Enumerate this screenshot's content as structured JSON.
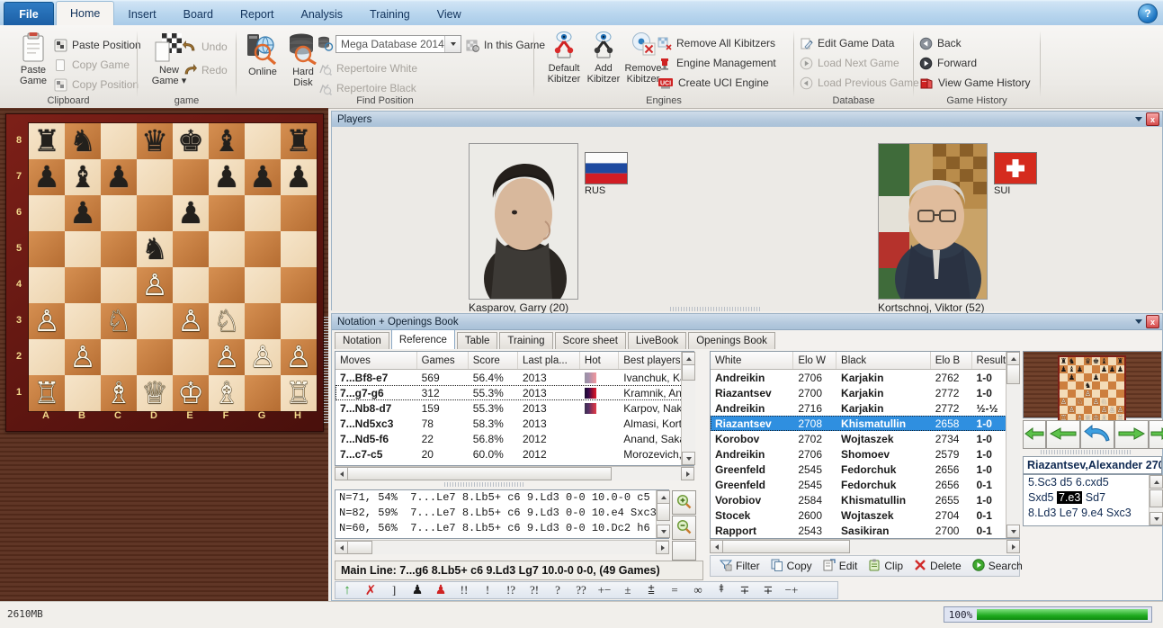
{
  "window": {
    "help_icon": "help-icon"
  },
  "ribbon": {
    "tabs": [
      {
        "label": "File",
        "active": false
      },
      {
        "label": "Home",
        "active": true
      },
      {
        "label": "Insert",
        "active": false
      },
      {
        "label": "Board",
        "active": false
      },
      {
        "label": "Report",
        "active": false
      },
      {
        "label": "Analysis",
        "active": false
      },
      {
        "label": "Training",
        "active": false
      },
      {
        "label": "View",
        "active": false
      }
    ],
    "groups": [
      {
        "name": "Clipboard",
        "label": "Clipboard"
      },
      {
        "name": "game",
        "label": "game"
      },
      {
        "name": "FindPosition",
        "label": "Find Position"
      },
      {
        "name": "Engines",
        "label": "Engines"
      },
      {
        "name": "Database",
        "label": "Database"
      },
      {
        "name": "GameHistory",
        "label": "Game History"
      }
    ],
    "clipboard": {
      "paste_game": "Paste\nGame",
      "paste_game_l1": "Paste",
      "paste_game_l2": "Game",
      "paste_position": "Paste Position",
      "copy_game": "Copy Game",
      "copy_position": "Copy Position"
    },
    "game": {
      "new_game_l1": "New",
      "new_game_l2": "Game",
      "undo": "Undo",
      "redo": "Redo"
    },
    "find": {
      "online_l1": "Online",
      "hard_disk_l1": "Hard",
      "hard_disk_l2": "Disk",
      "database": "Mega Database 2014",
      "in_this_game": "In this Game",
      "repertoire_white": "Repertoire White",
      "repertoire_black": "Repertoire Black"
    },
    "engines": {
      "default_l1": "Default",
      "default_l2": "Kibitzer",
      "add_l1": "Add",
      "add_l2": "Kibitzer",
      "remove_l1": "Remove",
      "remove_l2": "Kibitzer",
      "remove_all": "Remove All Kibitzers",
      "engine_management": "Engine Management",
      "create_uci": "Create UCI Engine"
    },
    "database": {
      "edit_game_data": "Edit Game Data",
      "load_next": "Load Next Game",
      "load_prev": "Load Previous Game"
    },
    "history": {
      "back": "Back",
      "forward": "Forward",
      "view_history": "View Game History"
    }
  },
  "board": {
    "files": [
      "A",
      "B",
      "C",
      "D",
      "E",
      "F",
      "G",
      "H"
    ],
    "ranks": [
      "8",
      "7",
      "6",
      "5",
      "4",
      "3",
      "2",
      "1"
    ],
    "rows": [
      [
        "br",
        "bn",
        "",
        "bq",
        "bk",
        "bb",
        "",
        "br"
      ],
      [
        "bp",
        "bb",
        "bp",
        "",
        "",
        "bp",
        "bp",
        "bp"
      ],
      [
        "",
        "bp",
        "",
        "",
        "bp",
        "",
        "",
        ""
      ],
      [
        "",
        "",
        "",
        "bn",
        "",
        "",
        "",
        ""
      ],
      [
        "",
        "",
        "",
        "wp",
        "",
        "",
        "",
        ""
      ],
      [
        "wp",
        "",
        "wn",
        "",
        "wp",
        "wn",
        "",
        ""
      ],
      [
        "",
        "wp",
        "",
        "",
        "",
        "wp",
        "wp",
        "wp"
      ],
      [
        "wr",
        "",
        "wb",
        "wq",
        "wk",
        "wb",
        "",
        "wr"
      ]
    ]
  },
  "players_panel": {
    "title": "Players",
    "white": {
      "name": "Kasparov, Garry  (20)",
      "country": "RUS",
      "flag": "russia-flag"
    },
    "black": {
      "name": "Kortschnoj, Viktor  (52)",
      "country": "SUI",
      "flag": "switzerland-flag"
    }
  },
  "notation_panel": {
    "title": "Notation + Openings Book",
    "tabs": [
      {
        "label": "Notation",
        "active": false
      },
      {
        "label": "Reference",
        "active": true
      },
      {
        "label": "Table",
        "active": false
      },
      {
        "label": "Training",
        "active": false
      },
      {
        "label": "Score sheet",
        "active": false
      },
      {
        "label": "LiveBook",
        "active": false
      },
      {
        "label": "Openings Book",
        "active": false
      }
    ],
    "moves_table": {
      "headers": [
        "Moves",
        "Games",
        "Score",
        "Last pla...",
        "Hot",
        "Best players"
      ],
      "rows": [
        {
          "move": "7...Bf8-e7",
          "games": "569",
          "score": "56.4%",
          "last": "2013",
          "hot": 0.15,
          "players": "Ivanchuk, Ka",
          "selected": false
        },
        {
          "move": "7...g7-g6",
          "games": "312",
          "score": "55.3%",
          "last": "2013",
          "hot": 1.0,
          "players": "Kramnik, Ana",
          "selected": true
        },
        {
          "move": "7...Nb8-d7",
          "games": "159",
          "score": "55.3%",
          "last": "2013",
          "hot": 0.85,
          "players": "Karpov, Naka",
          "selected": false
        },
        {
          "move": "7...Nd5xc3",
          "games": "78",
          "score": "58.3%",
          "last": "2013",
          "hot": 0,
          "players": "Almasi, Korts",
          "selected": false
        },
        {
          "move": "7...Nd5-f6",
          "games": "22",
          "score": "56.8%",
          "last": "2012",
          "hot": 0,
          "players": "Anand, Saka",
          "selected": false
        },
        {
          "move": "7...c7-c5",
          "games": "20",
          "score": "60.0%",
          "last": "2012",
          "hot": 0,
          "players": "Morozevich,",
          "selected": false
        }
      ]
    },
    "variations": [
      "N=71, 54%  7...Le7 8.Lb5+ c6 9.Ld3 0-0 10.0-0 c5",
      "N=82, 59%  7...Le7 8.Lb5+ c6 9.Ld3 0-0 10.e4 Sxc3",
      "N=60, 56%  7...Le7 8.Lb5+ c6 9.Ld3 0-0 10.Dc2 h6"
    ],
    "main_line": "Main Line: 7...g6 8.Lb5+ c6 9.Ld3 Lg7 10.0-0 0-0,  (49 Games)",
    "zoom_in_icon": "zoom-in-icon",
    "zoom_out_icon": "zoom-out-icon"
  },
  "games_table": {
    "headers": [
      "White",
      "Elo W",
      "Black",
      "Elo B",
      "Result"
    ],
    "rows": [
      {
        "white": "Andreikin",
        "elow": "2706",
        "black": "Karjakin",
        "elob": "2762",
        "result": "1-0",
        "selected": false
      },
      {
        "white": "Riazantsev",
        "elow": "2700",
        "black": "Karjakin",
        "elob": "2772",
        "result": "1-0",
        "selected": false
      },
      {
        "white": "Andreikin",
        "elow": "2716",
        "black": "Karjakin",
        "elob": "2772",
        "result": "½-½",
        "selected": false
      },
      {
        "white": "Riazantsev",
        "elow": "2708",
        "black": "Khismatullin",
        "elob": "2658",
        "result": "1-0",
        "selected": true
      },
      {
        "white": "Korobov",
        "elow": "2702",
        "black": "Wojtaszek",
        "elob": "2734",
        "result": "1-0",
        "selected": false
      },
      {
        "white": "Andreikin",
        "elow": "2706",
        "black": "Shomoev",
        "elob": "2579",
        "result": "1-0",
        "selected": false
      },
      {
        "white": "Greenfeld",
        "elow": "2545",
        "black": "Fedorchuk",
        "elob": "2656",
        "result": "1-0",
        "selected": false
      },
      {
        "white": "Greenfeld",
        "elow": "2545",
        "black": "Fedorchuk",
        "elob": "2656",
        "result": "0-1",
        "selected": false
      },
      {
        "white": "Vorobiov",
        "elow": "2584",
        "black": "Khismatullin",
        "elob": "2655",
        "result": "1-0",
        "selected": false
      },
      {
        "white": "Stocek",
        "elow": "2600",
        "black": "Wojtaszek",
        "elob": "2704",
        "result": "0-1",
        "selected": false
      },
      {
        "white": "Rapport",
        "elow": "2543",
        "black": "Sasikiran",
        "elob": "2700",
        "result": "0-1",
        "selected": false
      }
    ]
  },
  "action_bar": {
    "items": [
      {
        "label": "Filter",
        "icon": "filter-icon"
      },
      {
        "label": "Copy",
        "icon": "copy-icon"
      },
      {
        "label": "Edit",
        "icon": "edit-icon"
      },
      {
        "label": "Clip",
        "icon": "clipboard-icon"
      },
      {
        "label": "Delete",
        "icon": "delete-icon"
      },
      {
        "label": "Search",
        "icon": "search-play-icon"
      }
    ]
  },
  "symbol_bar": {
    "symbols": [
      "↑",
      "✗",
      "]",
      "♟",
      "♟",
      "!!",
      "!",
      "!?",
      "?!",
      "?",
      "??",
      "+−",
      "±",
      "⩲",
      "=",
      "∞",
      "⯒",
      "∓",
      "∓",
      "−+"
    ]
  },
  "preview_panel": {
    "nav_icons": [
      "arrow-left-icon",
      "arrow-left-icon",
      "arrow-undo-icon",
      "arrow-right-icon",
      "arrow-right-icon"
    ],
    "game_header": "Riazantsev,Alexander 270",
    "move_lines": [
      {
        "pre": "5.Sc3  d5  6.cxd5",
        "hl": "",
        "post": ""
      },
      {
        "pre": "Sxd5 ",
        "hl": "7.e3",
        "post": " Sd7"
      },
      {
        "pre": "8.Ld3  Le7  9.e4  Sxc3",
        "hl": "",
        "post": ""
      }
    ],
    "mini_board_rows": [
      [
        "br",
        "bn",
        "",
        "bq",
        "bk",
        "bb",
        "",
        "br"
      ],
      [
        "bp",
        "bb",
        "bp",
        "",
        "",
        "bp",
        "bp",
        "bp"
      ],
      [
        "",
        "bp",
        "",
        "",
        "bp",
        "",
        "",
        ""
      ],
      [
        "",
        "",
        "",
        "bn",
        "",
        "",
        "",
        ""
      ],
      [
        "",
        "",
        "",
        "wp",
        "",
        "",
        "",
        ""
      ],
      [
        "wp",
        "",
        "wn",
        "",
        "wp",
        "wn",
        "",
        ""
      ],
      [
        "",
        "wp",
        "",
        "",
        "",
        "wp",
        "wp",
        "wp"
      ],
      [
        "wr",
        "",
        "wb",
        "wq",
        "wk",
        "wb",
        "",
        "wr"
      ]
    ]
  },
  "status_bar": {
    "memory": "2610MB",
    "progress_label": "100%",
    "progress_value": 100
  }
}
